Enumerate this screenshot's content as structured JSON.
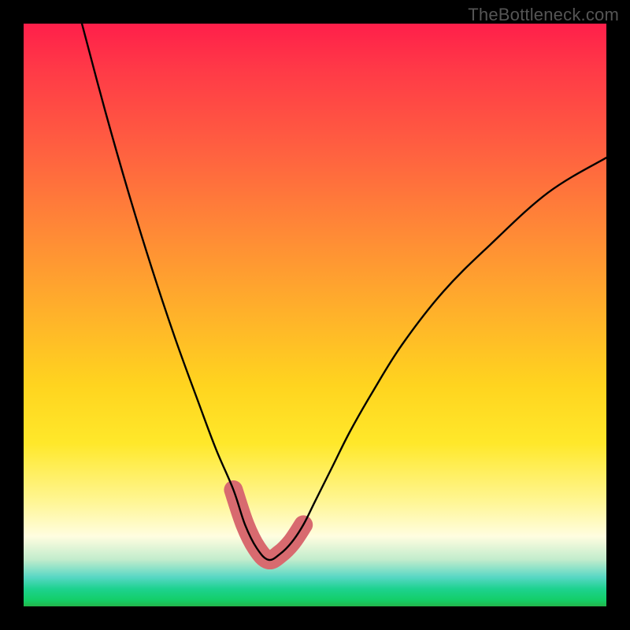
{
  "watermark": "TheBottleneck.com",
  "chart_data": {
    "type": "line",
    "title": "",
    "xlabel": "",
    "ylabel": "",
    "xlim": [
      0,
      100
    ],
    "ylim": [
      0,
      100
    ],
    "series": [
      {
        "name": "main-curve",
        "x": [
          10,
          14,
          18,
          22,
          26,
          30,
          33,
          36,
          38,
          40,
          42,
          44,
          46,
          48,
          50,
          53,
          56,
          60,
          65,
          72,
          80,
          90,
          100
        ],
        "y": [
          100,
          85,
          71,
          58,
          46,
          35,
          27,
          20,
          14,
          10,
          8,
          9,
          11,
          14,
          18,
          24,
          30,
          37,
          45,
          54,
          62,
          71,
          77
        ]
      },
      {
        "name": "highlight-band",
        "x": [
          36,
          38,
          40,
          42,
          44,
          46,
          48
        ],
        "y": [
          20,
          14,
          10,
          8,
          9,
          11,
          14
        ]
      }
    ],
    "annotations": [],
    "grid": false,
    "legend": false,
    "background_gradient": [
      "#ff1f4a",
      "#ffd41f",
      "#fffde0",
      "#13ce66"
    ]
  }
}
